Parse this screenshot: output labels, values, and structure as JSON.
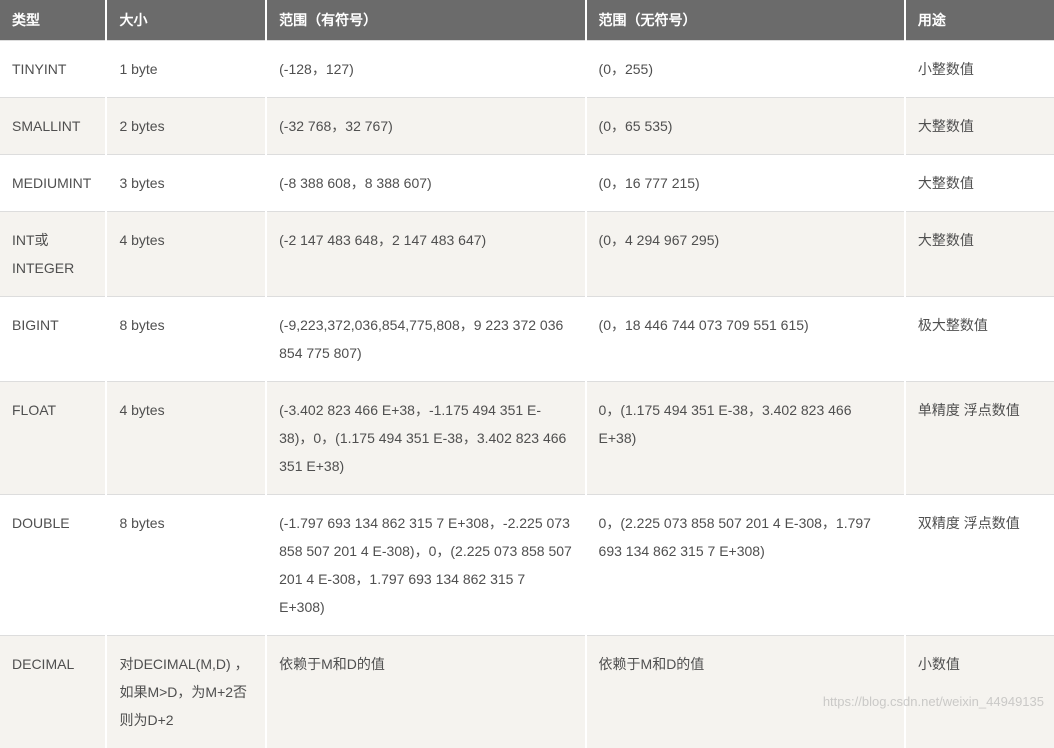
{
  "watermark": "https://blog.csdn.net/weixin_44949135",
  "table": {
    "headers": [
      "类型",
      "大小",
      "范围（有符号）",
      "范围（无符号）",
      "用途"
    ],
    "rows": [
      {
        "type": "TINYINT",
        "size": "1 byte",
        "signed": "(-128，127)",
        "unsigned": "(0，255)",
        "usage": "小整数值"
      },
      {
        "type": "SMALLINT",
        "size": "2 bytes",
        "signed": "(-32 768，32 767)",
        "unsigned": "(0，65 535)",
        "usage": "大整数值"
      },
      {
        "type": "MEDIUMINT",
        "size": "3 bytes",
        "signed": "(-8 388 608，8 388 607)",
        "unsigned": "(0，16 777 215)",
        "usage": "大整数值"
      },
      {
        "type": "INT或INTEGER",
        "size": "4 bytes",
        "signed": "(-2 147 483 648，2 147 483 647)",
        "unsigned": "(0，4 294 967 295)",
        "usage": "大整数值"
      },
      {
        "type": "BIGINT",
        "size": "8 bytes",
        "signed": "(-9,223,372,036,854,775,808，9 223 372 036 854 775 807)",
        "unsigned": "(0，18 446 744 073 709 551 615)",
        "usage": "极大整数值"
      },
      {
        "type": "FLOAT",
        "size": "4 bytes",
        "signed": "(-3.402 823 466 E+38，-1.175 494 351 E-38)，0，(1.175 494 351 E-38，3.402 823 466 351 E+38)",
        "unsigned": "0，(1.175 494 351 E-38，3.402 823 466 E+38)",
        "usage": "单精度 浮点数值"
      },
      {
        "type": "DOUBLE",
        "size": "8 bytes",
        "signed": "(-1.797 693 134 862 315 7 E+308，-2.225 073 858 507 201 4 E-308)，0，(2.225 073 858 507 201 4 E-308，1.797 693 134 862 315 7 E+308)",
        "unsigned": "0，(2.225 073 858 507 201 4 E-308，1.797 693 134 862 315 7 E+308)",
        "usage": "双精度 浮点数值"
      },
      {
        "type": "DECIMAL",
        "size": "对DECIMAL(M,D) ，如果M>D，为M+2否则为D+2",
        "signed": "依赖于M和D的值",
        "unsigned": "依赖于M和D的值",
        "usage": "小数值"
      }
    ]
  }
}
